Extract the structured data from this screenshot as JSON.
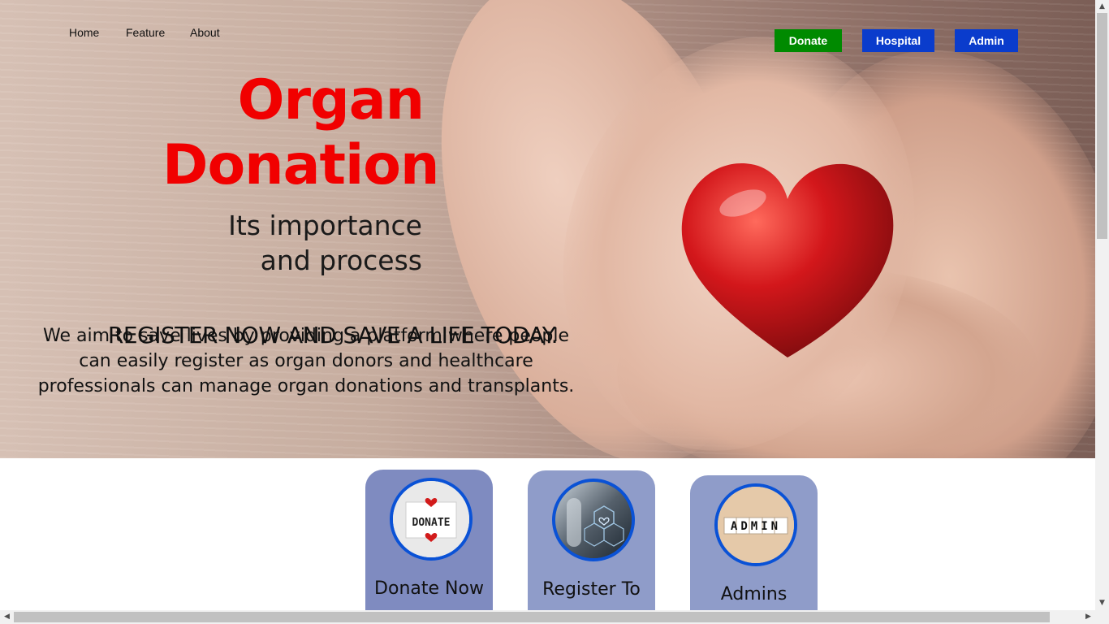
{
  "nav": {
    "home": "Home",
    "feature": "Feature",
    "about": "About"
  },
  "buttons": {
    "donate": "Donate",
    "hospital": "Hospital",
    "admin": "Admin"
  },
  "hero": {
    "title_line1": "Organ",
    "title_line2": "Donation",
    "subtitle_line1": "Its importance",
    "subtitle_line2": "and process",
    "register": "REGISTER NOW AND SAVE A LIFE TODAY.",
    "aim": "We aim to save lives by providing a platform where people can easily register as organ donors and healthcare professionals can manage organ donations and transplants."
  },
  "cards": {
    "donate": {
      "label": "Donate Now",
      "image_text": "DONATE"
    },
    "register": {
      "label": "Register To"
    },
    "admins": {
      "label": "Admins",
      "image_text": "ADMIN"
    }
  },
  "colors": {
    "accent_red": "#f10000",
    "donate_btn": "#008a00",
    "nav_btn_blue": "#0a3ccc",
    "card_bg": "#8f9cc9",
    "circle_border": "#0a52d6"
  }
}
